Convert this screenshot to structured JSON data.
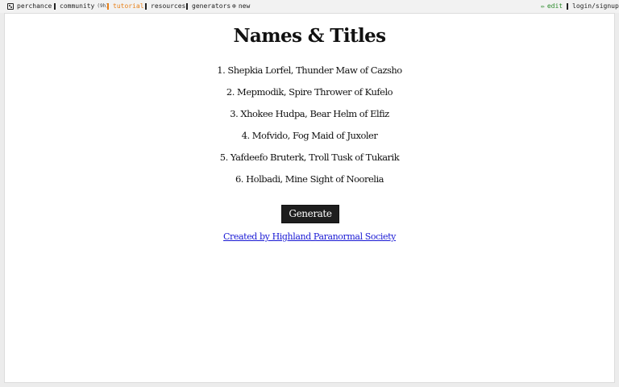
{
  "nav": {
    "perchance": "perchance",
    "community": "community",
    "community_count": "(9h)",
    "tutorial": "tutorial",
    "resources": "resources",
    "generators": "generators",
    "new": "new",
    "edit": "edit",
    "login": "login/signup"
  },
  "icons": {
    "new": "⊕",
    "edit": "✏"
  },
  "colors": {
    "tutorial": "#e8811a",
    "edit": "#2a8a2a",
    "link": "#1a1ad4",
    "button": "#1e1e1e"
  },
  "main": {
    "title": "Names & Titles",
    "names": [
      "1. Shepkia Lorfel, Thunder Maw of Cazsho",
      "2. Mepmodik, Spire Thrower of Kufelo",
      "3. Xhokee Hudpa, Bear Helm of Elfiz",
      "4. Mofvido, Fog Maid of Juxoler",
      "5. Yafdeefo Bruterk, Troll Tusk of Tukarik",
      "6. Holbadi, Mine Sight of Noorelia"
    ],
    "generate_label": "Generate",
    "credit": "Created by Highland Paranormal Society"
  }
}
